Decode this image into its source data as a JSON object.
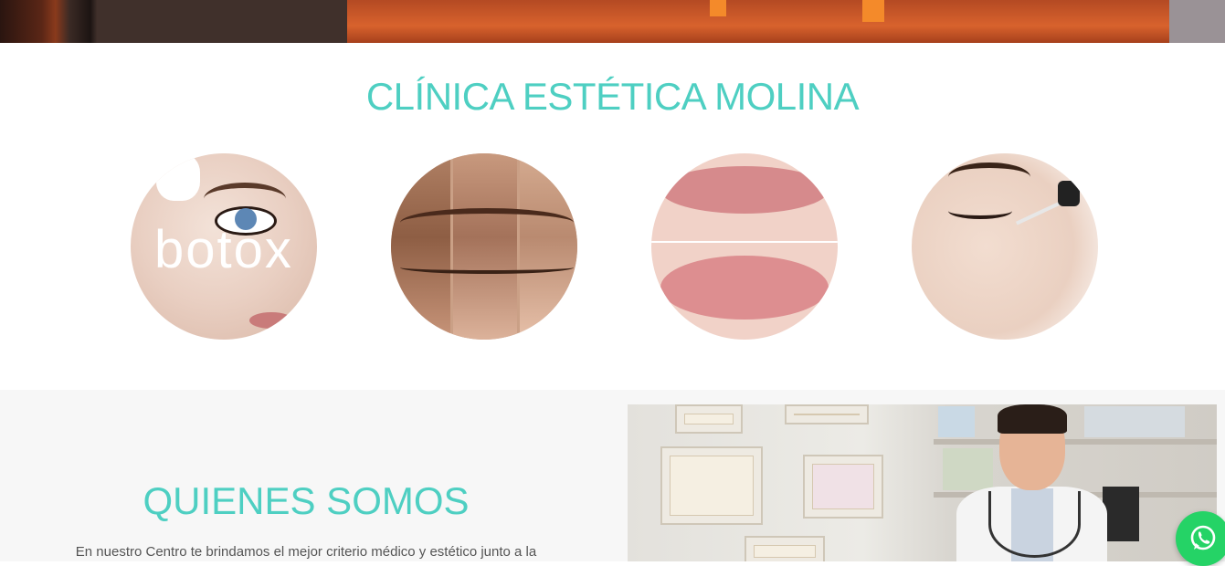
{
  "header": {
    "title": "CLÍNICA ESTÉTICA MOLINA"
  },
  "services": [
    {
      "label": "botox",
      "icon": "botox-treatment-image"
    },
    {
      "label": "",
      "icon": "wrinkle-treatment-image"
    },
    {
      "label": "",
      "icon": "lip-filler-image"
    },
    {
      "label": "",
      "icon": "skin-serum-image"
    }
  ],
  "about": {
    "title": "QUIENES SOMOS",
    "text": "En nuestro Centro te brindamos el mejor criterio médico y estético junto a la"
  },
  "colors": {
    "accent": "#4ecfc2",
    "whatsapp": "#25d366",
    "section_bg": "#f7f7f7"
  },
  "floating": {
    "whatsapp_icon": "whatsapp-icon"
  }
}
